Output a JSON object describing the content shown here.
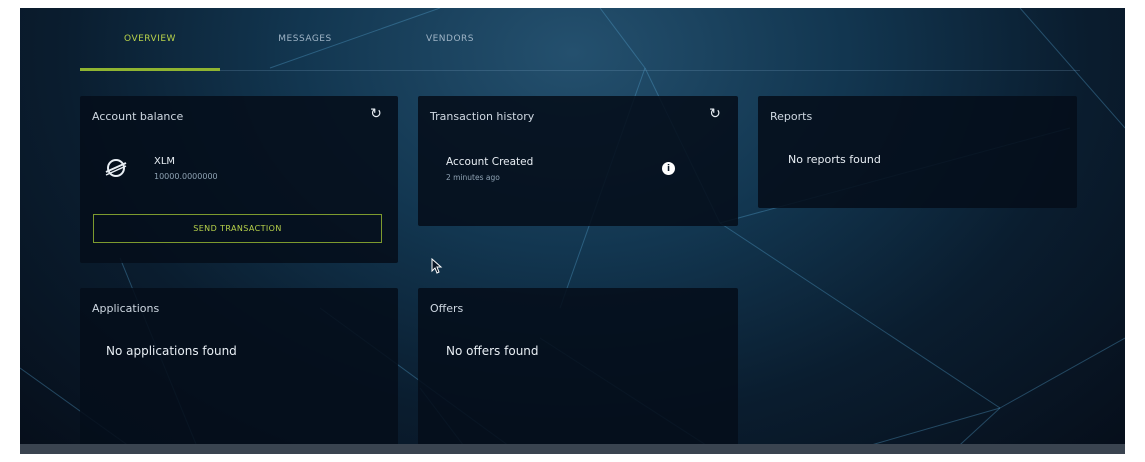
{
  "tabs": [
    {
      "label": "Overview",
      "active": true
    },
    {
      "label": "Messages",
      "active": false
    },
    {
      "label": "Vendors",
      "active": false
    }
  ],
  "account_balance": {
    "title": "Account balance",
    "refresh_icon": "refresh-icon",
    "asset": {
      "icon": "stellar-icon",
      "code": "XLM",
      "amount": "10000.0000000"
    },
    "send_button": "SEND TRANSACTION"
  },
  "transaction_history": {
    "title": "Transaction history",
    "refresh_icon": "refresh-icon",
    "items": [
      {
        "name": "Account Created",
        "time": "2 minutes ago",
        "icon": "info-icon"
      }
    ]
  },
  "reports": {
    "title": "Reports",
    "empty_text": "No reports found"
  },
  "applications": {
    "title": "Applications",
    "empty_text": "No applications found"
  },
  "offers": {
    "title": "Offers",
    "empty_text": "No offers found"
  },
  "colors": {
    "accent": "#8fb431",
    "card_bg": "#050e1a",
    "background": "#123650"
  }
}
